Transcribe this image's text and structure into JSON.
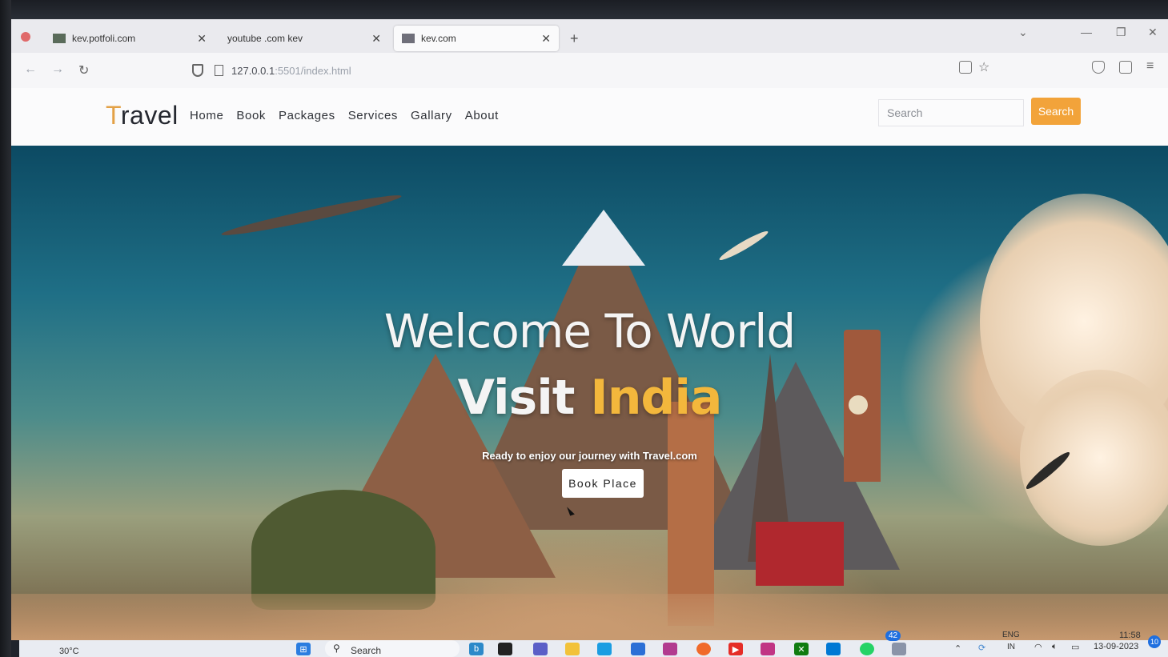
{
  "browser": {
    "tabs": [
      {
        "label": "kev.potfoli.com"
      },
      {
        "label": "youtube .com kev"
      },
      {
        "label": "kev.com"
      }
    ],
    "url_host": "127.0.0.1",
    "url_path": ":5501/index.html"
  },
  "site": {
    "logo_first": "T",
    "logo_rest": "ravel",
    "menu": [
      "Home",
      "Book",
      "Packages",
      "Services",
      "Gallary",
      "About"
    ],
    "search_placeholder": "Search",
    "search_button": "Search"
  },
  "hero": {
    "title_line1": "Welcome To World",
    "title_line2_prefix": "Visit ",
    "title_line2_accent": "India",
    "tagline": "Ready to enjoy our journey with Travel.com",
    "button": "Book Place"
  },
  "taskbar": {
    "weather": "30°C",
    "search": "Search",
    "lang_top": "ENG",
    "lang_bottom": "IN",
    "time": "11:58",
    "date": "13-09-2023",
    "whatsapp_badge": "42",
    "notification_count": "10"
  },
  "colors": {
    "accent": "#f2a33a",
    "title_accent": "#f3b73c"
  }
}
